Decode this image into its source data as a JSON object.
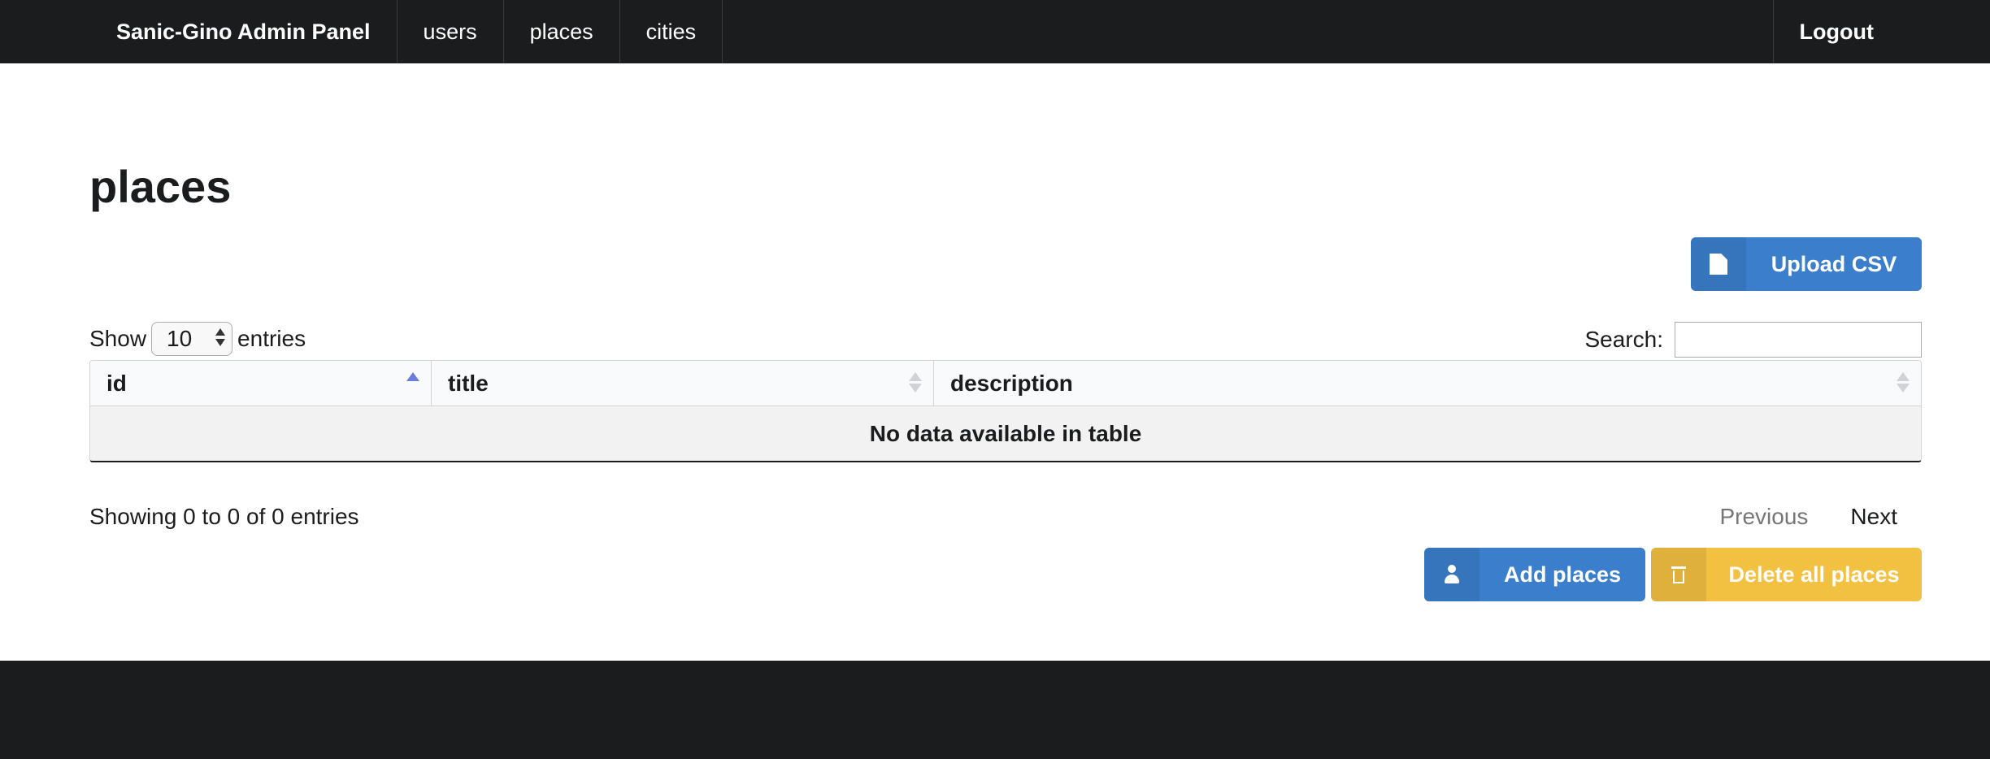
{
  "nav": {
    "brand": "Sanic-Gino Admin Panel",
    "links": [
      "users",
      "places",
      "cities"
    ],
    "logout": "Logout"
  },
  "page": {
    "title": "places"
  },
  "actions": {
    "upload": {
      "label": "Upload CSV",
      "icon": "file-icon",
      "color": "#3b7fcc"
    },
    "add": {
      "label": "Add places",
      "icon": "user-icon",
      "color": "#3b7fcc"
    },
    "delete": {
      "label": "Delete all places",
      "icon": "trash-icon",
      "color": "#f2c142"
    }
  },
  "table": {
    "length": {
      "prefix": "Show",
      "value": "10",
      "suffix": "entries"
    },
    "search": {
      "label": "Search:",
      "value": ""
    },
    "columns": [
      {
        "label": "id",
        "sort": "ascending"
      },
      {
        "label": "title",
        "sort": "none"
      },
      {
        "label": "description",
        "sort": "none"
      }
    ],
    "empty_message": "No data available in table",
    "info": "Showing 0 to 0 of 0 entries",
    "pagination": {
      "previous": "Previous",
      "next": "Next"
    }
  }
}
